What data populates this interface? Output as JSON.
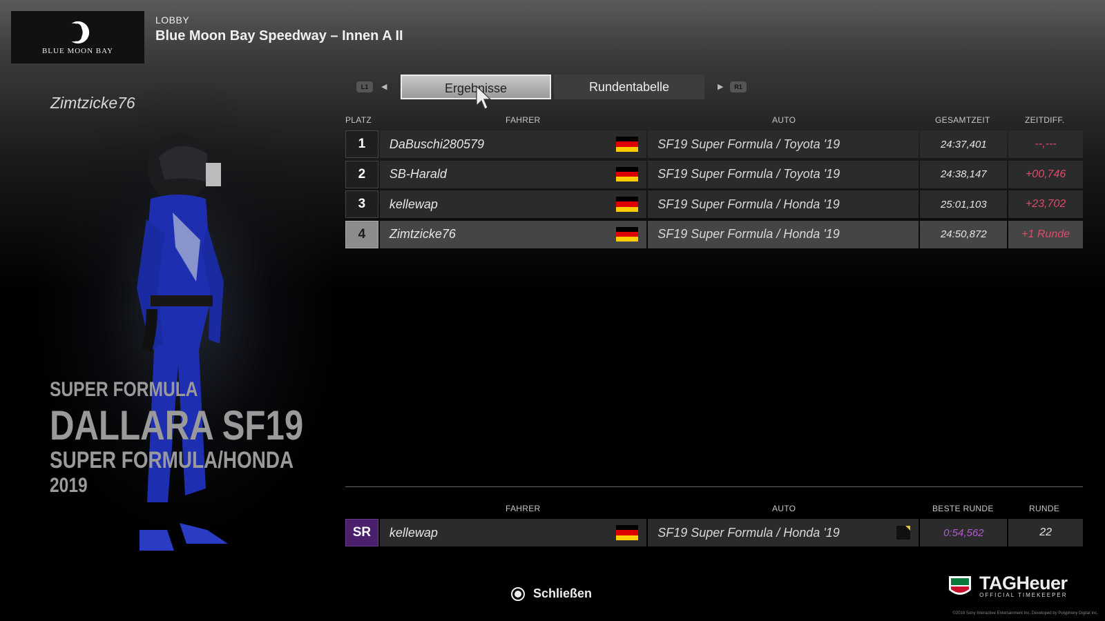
{
  "header": {
    "logo_text": "BLUE MOON BAY",
    "section_label": "LOBBY",
    "track_title": "Blue Moon Bay Speedway – Innen A II"
  },
  "player": {
    "name": "Zimtzicke76",
    "car_series": "SUPER FORMULA",
    "car_model": "DALLARA SF19",
    "car_subtitle": "SUPER FORMULA/HONDA",
    "car_year": "2019"
  },
  "tabs": {
    "left_button": "L1",
    "right_button": "R1",
    "items": [
      {
        "label": "Ergebnisse",
        "active": true
      },
      {
        "label": "Rundentabelle",
        "active": false
      }
    ]
  },
  "results": {
    "headers": {
      "pos": "PLATZ",
      "driver": "FAHRER",
      "car": "AUTO",
      "total": "GESAMTZEIT",
      "diff": "ZEITDIFF."
    },
    "rows": [
      {
        "pos": "1",
        "driver": "DaBuschi280579",
        "car": "SF19 Super Formula / Toyota '19",
        "total": "24:37,401",
        "diff": "--,---"
      },
      {
        "pos": "2",
        "driver": "SB-Harald",
        "car": "SF19 Super Formula / Toyota '19",
        "total": "24:38,147",
        "diff": "+00,746"
      },
      {
        "pos": "3",
        "driver": "kellewap",
        "car": "SF19 Super Formula / Honda '19",
        "total": "25:01,103",
        "diff": "+23,702"
      },
      {
        "pos": "4",
        "driver": "Zimtzicke76",
        "car": "SF19 Super Formula / Honda '19",
        "total": "24:50,872",
        "diff": "+1 Runde"
      }
    ]
  },
  "fastest_lap": {
    "headers": {
      "driver": "FAHRER",
      "car": "AUTO",
      "best": "BESTE RUNDE",
      "lap": "RUNDE"
    },
    "badge": "SR",
    "driver": "kellewap",
    "car": "SF19 Super Formula / Honda '19",
    "best": "0:54,562",
    "lap": "22"
  },
  "footer": {
    "close_label": "Schließen",
    "sponsor_name": "TAGHeuer",
    "sponsor_sub": "OFFICIAL TIMEKEEPER",
    "copyright": "©2019 Sony Interactive Entertainment Inc. Developed by Polyphony Digital Inc."
  },
  "colors": {
    "diff": "#e04a6a",
    "best_lap": "#b55ad6",
    "sr_badge": "#4a1f6b"
  }
}
